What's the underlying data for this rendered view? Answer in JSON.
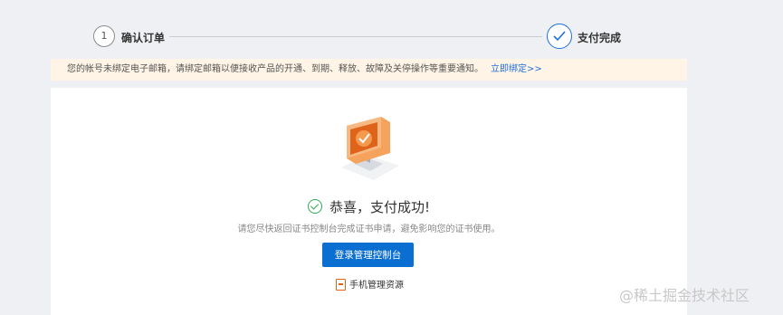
{
  "stepper": {
    "step1_number": "1",
    "step1_label": "确认订单",
    "step2_label": "支付完成"
  },
  "notice": {
    "text": "您的帐号未绑定电子邮箱，请绑定邮箱以便接收产品的开通、到期、释放、故障及关停操作等重要通知。",
    "link": "立即绑定>>"
  },
  "result": {
    "title": "恭喜，支付成功!",
    "hint": "请您尽快返回证书控制台完成证书申请，避免影响您的证书使用。",
    "console_button": "登录管理控制台",
    "mobile_link": "手机管理资源"
  },
  "watermark": "@稀土掘金技术社区",
  "colors": {
    "primary": "#0a6fd0",
    "success": "#2da94f",
    "notice_bg": "#fff4e6",
    "accent_orange": "#e0631b"
  },
  "icons": [
    "check-icon",
    "success-check-icon",
    "monitor-illustration",
    "phone-icon"
  ]
}
